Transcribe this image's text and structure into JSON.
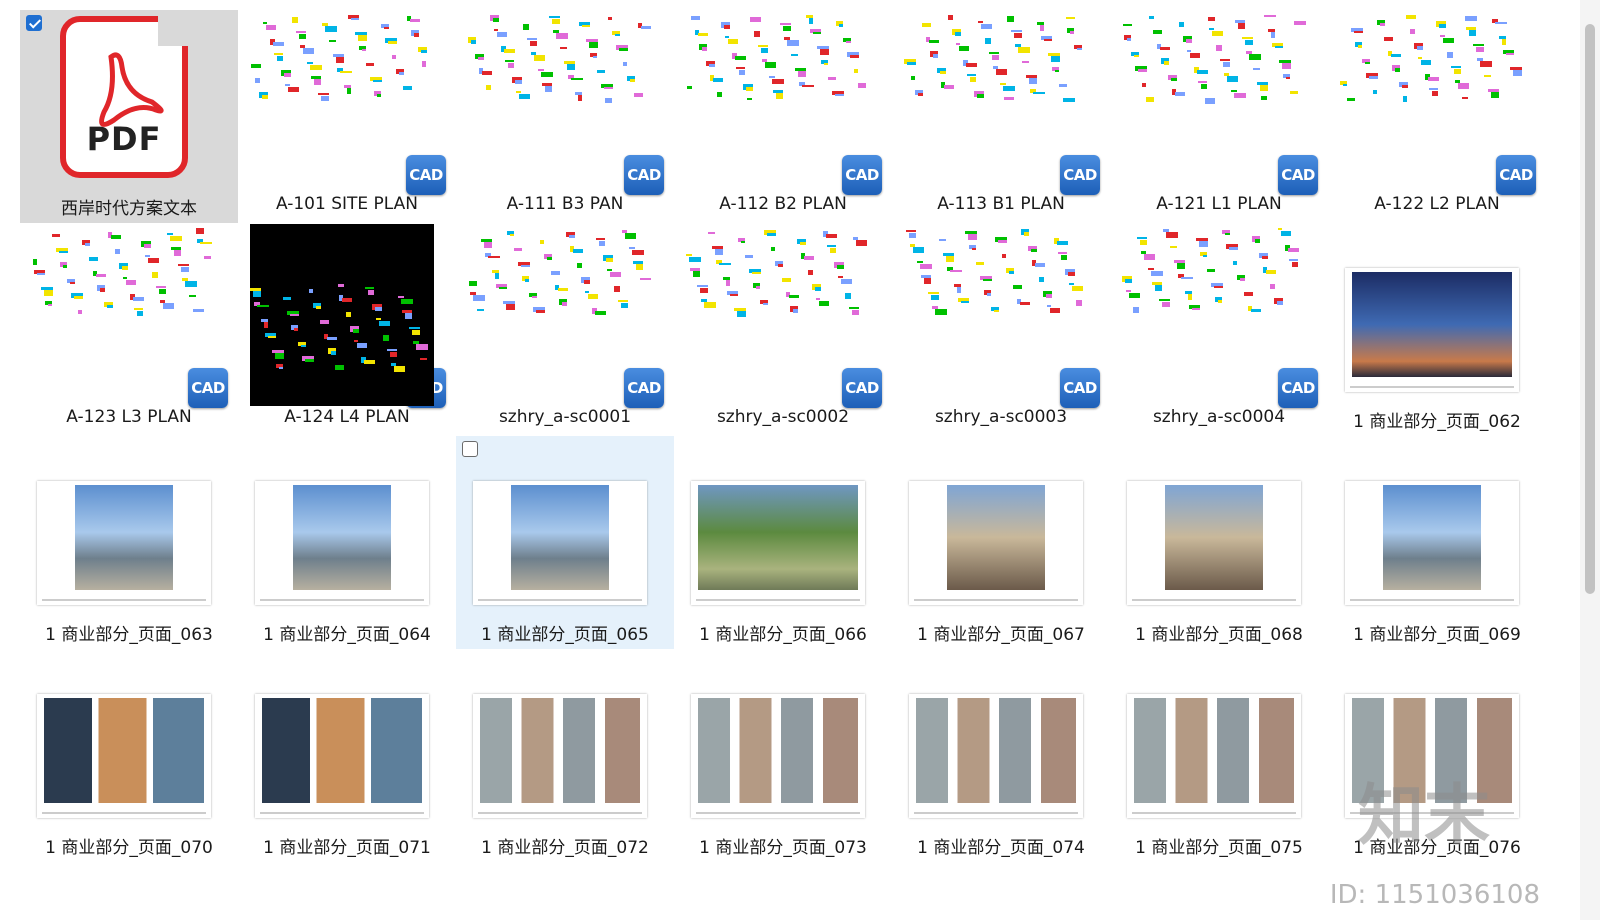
{
  "files": [
    {
      "name": "西岸时代方案文本",
      "kind": "pdf",
      "selected": true,
      "pdf_label": "PDF"
    },
    {
      "name": "A-101 SITE PLAN",
      "kind": "cad"
    },
    {
      "name": "A-111 B3 PAN",
      "kind": "cad"
    },
    {
      "name": "A-112  B2 PLAN",
      "kind": "cad"
    },
    {
      "name": "A-113 B1 PLAN",
      "kind": "cad"
    },
    {
      "name": "A-121  L1 PLAN",
      "kind": "cad"
    },
    {
      "name": "A-122  L2 PLAN",
      "kind": "cad"
    },
    {
      "name": "A-123 L3 PLAN",
      "kind": "cad"
    },
    {
      "name": "A-124   L4 PLAN",
      "kind": "cad",
      "dark": true
    },
    {
      "name": "szhry_a-sc0001",
      "kind": "cad"
    },
    {
      "name": "szhry_a-sc0002",
      "kind": "cad"
    },
    {
      "name": "szhry_a-sc0003",
      "kind": "cad"
    },
    {
      "name": "szhry_a-sc0004",
      "kind": "cad"
    },
    {
      "name": "1 商业部分_页面_062",
      "kind": "img",
      "scene": "night",
      "wide": true
    },
    {
      "name": "1 商业部分_页面_063",
      "kind": "img",
      "scene": "city"
    },
    {
      "name": "1 商业部分_页面_064",
      "kind": "img",
      "scene": "city"
    },
    {
      "name": "1 商业部分_页面_065",
      "kind": "img",
      "scene": "city",
      "hovered": true
    },
    {
      "name": "1 商业部分_页面_066",
      "kind": "img",
      "scene": "green",
      "wide": true
    },
    {
      "name": "1 商业部分_页面_067",
      "kind": "img",
      "scene": "plaza"
    },
    {
      "name": "1 商业部分_页面_068",
      "kind": "img",
      "scene": "plaza"
    },
    {
      "name": "1 商业部分_页面_069",
      "kind": "img",
      "scene": "city"
    },
    {
      "name": "1 商业部分_页面_070",
      "kind": "img",
      "scene": "collage",
      "wide": true
    },
    {
      "name": "1 商业部分_页面_071",
      "kind": "img",
      "scene": "collage",
      "wide": true
    },
    {
      "name": "1 商业部分_页面_072",
      "kind": "img",
      "scene": "elev",
      "wide": true
    },
    {
      "name": "1 商业部分_页面_073",
      "kind": "img",
      "scene": "elev",
      "wide": true
    },
    {
      "name": "1 商业部分_页面_074",
      "kind": "img",
      "scene": "elev",
      "wide": true
    },
    {
      "name": "1 商业部分_页面_075",
      "kind": "img",
      "scene": "elev",
      "wide": true
    },
    {
      "name": "1 商业部分_页面_076",
      "kind": "img",
      "scene": "elev",
      "wide": true
    }
  ],
  "cad_badge": "CAD",
  "watermark": {
    "logo": "知末",
    "id": "ID: 1151036108"
  }
}
